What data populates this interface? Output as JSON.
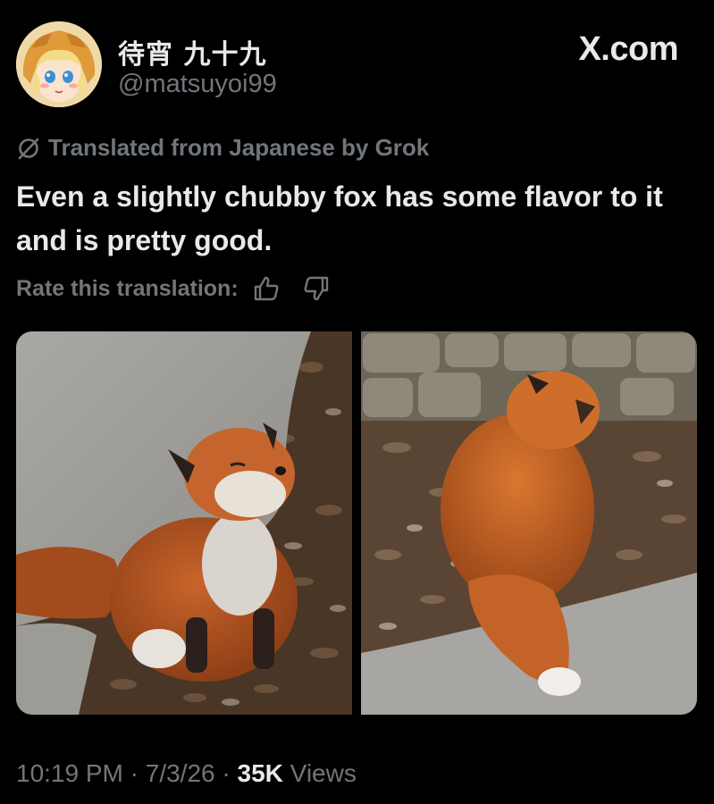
{
  "author": {
    "display_name": "待宵 九十九",
    "handle": "@matsuyoi99"
  },
  "brand": "X.com",
  "translation": {
    "notice": "Translated from Japanese by Grok",
    "rate_label": "Rate this translation:"
  },
  "tweet": {
    "text": "Even a slightly chubby fox has some flavor to it and is pretty good."
  },
  "media": {
    "count": 2,
    "photos": [
      "fox-sitting-front",
      "fox-sitting-back"
    ]
  },
  "meta": {
    "time": "10:19 PM",
    "date": "7/3/26",
    "views_count": "35K",
    "views_label": "Views",
    "separator": "·"
  },
  "colors": {
    "background": "#000000",
    "primary_text": "#e7e9ea",
    "secondary_text": "#71767b"
  },
  "icons": [
    "grok-translate-icon",
    "thumbs-up-icon",
    "thumbs-down-icon"
  ]
}
